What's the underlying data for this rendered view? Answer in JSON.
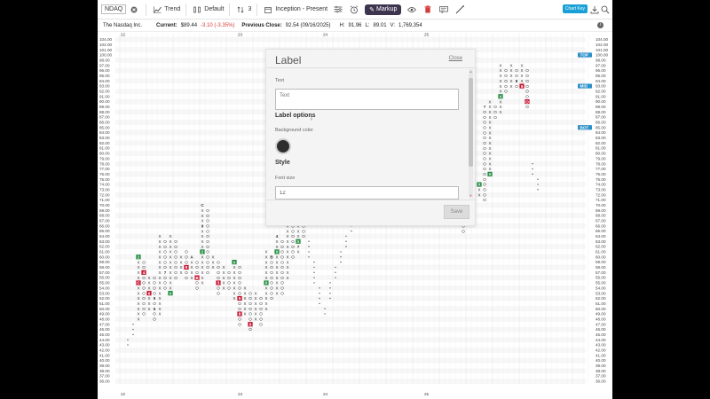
{
  "toolbar": {
    "symbol": "NDAQ",
    "trend_label": "Trend",
    "default_label": "Default",
    "count_label": "3",
    "range_label": "Inception - Present",
    "markup_label": "Markup",
    "chart_key_label": "Chart Key"
  },
  "info": {
    "company": "The Nasdaq Inc.",
    "current_label": "Current:",
    "current_value": "$89.44",
    "change": "-3.10 (-3.35%)",
    "prev_label": "Previous Close:",
    "prev_value": "92.54 (09/16/2025)",
    "high_label": "H:",
    "high_value": "91.96",
    "low_label": "L:",
    "low_value": "89.01",
    "vol_label": "V:",
    "vol_value": "1,769,354"
  },
  "modal": {
    "title": "Label",
    "close": "Close",
    "text_label": "Text",
    "text_placeholder": "Text",
    "options_heading": "Label options",
    "bg_label": "Background color",
    "bg_color": "#2d2d2d",
    "style_heading": "Style",
    "font_size_label": "Font size",
    "font_size_value": "12",
    "save": "Save"
  },
  "chart_data": {
    "type": "point-and-figure",
    "price_axis": [
      "104.00",
      "102.00",
      "101.00",
      "100.00",
      "98.00",
      "97.00",
      "96.00",
      "95.00",
      "94.00",
      "93.00",
      "92.00",
      "91.00",
      "90.00",
      "89.00",
      "88.00",
      "87.00",
      "86.00",
      "85.00",
      "84.00",
      "83.00",
      "82.00",
      "81.00",
      "80.00",
      "79.00",
      "78.00",
      "77.00",
      "76.00",
      "75.00",
      "74.00",
      "73.00",
      "72.00",
      "71.00",
      "70.00",
      "69.00",
      "68.00",
      "67.00",
      "66.00",
      "65.00",
      "64.00",
      "63.00",
      "62.00",
      "61.00",
      "60.00",
      "59.00",
      "58.00",
      "57.00",
      "56.00",
      "55.00",
      "54.00",
      "53.00",
      "52.00",
      "51.00",
      "50.00",
      "49.00",
      "48.00",
      "47.00",
      "46.00",
      "45.00",
      "44.00",
      "43.00",
      "42.00",
      "41.00",
      "40.00",
      "39.00",
      "38.00",
      "37.00",
      "36.00"
    ],
    "period_labels": [
      {
        "label": "22",
        "col": 0
      },
      {
        "label": "23",
        "col": 22
      },
      {
        "label": "24",
        "col": 38
      },
      {
        "label": "25",
        "col": 57
      }
    ],
    "right_tags": [
      {
        "label": "TOP",
        "price": 100
      },
      {
        "label": "MID",
        "price": 93
      },
      {
        "label": "BOT",
        "price": 85
      }
    ],
    "columns": [
      {
        "col": 1,
        "type": "dot",
        "from": 43,
        "to": 44
      },
      {
        "col": 2,
        "type": "dot",
        "from": 45,
        "to": 47
      },
      {
        "col": 3,
        "type": "X",
        "from": 48,
        "to": 60,
        "marks": [
          {
            "price": 55,
            "text": "C",
            "color": "#c8102e"
          },
          {
            "price": 60,
            "text": "2",
            "color": "#1e8a3c"
          }
        ]
      },
      {
        "col": 4,
        "type": "O",
        "from": 49,
        "to": 59,
        "marks": [
          {
            "price": 57,
            "text": "4",
            "color": "#c8102e"
          }
        ]
      },
      {
        "col": 5,
        "type": "X",
        "from": 50,
        "to": 56,
        "marks": [
          {
            "price": 53,
            "text": "6",
            "color": "#c8102e"
          }
        ]
      },
      {
        "col": 6,
        "type": "O",
        "from": 48,
        "to": 56,
        "marks": [
          {
            "price": 52,
            "text": "5",
            "color": "#333333"
          },
          {
            "price": 50,
            "text": "6",
            "color": "#333333"
          }
        ]
      },
      {
        "col": 7,
        "type": "X",
        "from": 49,
        "to": 64
      },
      {
        "col": 8,
        "type": "O",
        "from": 54,
        "to": 63,
        "marks": [
          {
            "price": 57,
            "text": "7",
            "color": "#333333"
          }
        ]
      },
      {
        "col": 9,
        "type": "X",
        "from": 53,
        "to": 64,
        "marks": [
          {
            "price": 53,
            "text": "X",
            "color": "#1e8a3c"
          }
        ]
      },
      {
        "col": 10,
        "type": "O",
        "from": 56,
        "to": 63
      },
      {
        "col": 11,
        "type": "X",
        "from": 57,
        "to": 60
      },
      {
        "col": 12,
        "type": "O",
        "from": 56,
        "to": 61,
        "marks": [
          {
            "price": 58,
            "text": "8",
            "color": "#c8102e"
          }
        ]
      },
      {
        "col": 13,
        "type": "X",
        "from": 56,
        "to": 60,
        "marks": [
          {
            "price": 60,
            "text": "A",
            "color": "#333333"
          }
        ]
      },
      {
        "col": 14,
        "type": "O",
        "from": 54,
        "to": 59,
        "marks": [
          {
            "price": 56,
            "text": "B",
            "color": "#c8102e"
          }
        ]
      },
      {
        "col": 15,
        "type": "X",
        "from": 55,
        "to": 70,
        "marks": [
          {
            "price": 70,
            "text": "C",
            "color": "#333333"
          },
          {
            "price": 61,
            "text": "2",
            "color": "#1e8a3c"
          },
          {
            "price": 66,
            "text": "9",
            "color": "#333333"
          }
        ]
      },
      {
        "col": 16,
        "type": "O",
        "from": 57,
        "to": 69
      },
      {
        "col": 17,
        "type": "X",
        "from": 58,
        "to": 60
      },
      {
        "col": 18,
        "type": "O",
        "from": 53,
        "to": 59,
        "marks": [
          {
            "price": 55,
            "text": "3",
            "color": "#c8102e"
          }
        ]
      },
      {
        "col": 19,
        "type": "X",
        "from": 54,
        "to": 58
      },
      {
        "col": 20,
        "type": "O",
        "from": 54,
        "to": 57
      },
      {
        "col": 21,
        "type": "X",
        "from": 52,
        "to": 59,
        "marks": [
          {
            "price": 59,
            "text": "X",
            "color": "#1e8a3c"
          }
        ]
      },
      {
        "col": 22,
        "type": "O",
        "from": 47,
        "to": 58,
        "marks": [
          {
            "price": 52,
            "text": "6",
            "color": "#c8102e"
          },
          {
            "price": 49,
            "text": "8",
            "color": "#c8102e"
          }
        ]
      },
      {
        "col": 23,
        "type": "X",
        "from": 49,
        "to": 54
      },
      {
        "col": 24,
        "type": "O",
        "from": 46,
        "to": 53,
        "marks": [
          {
            "price": 47,
            "text": "8",
            "color": "#c8102e"
          }
        ]
      },
      {
        "col": 25,
        "type": "X",
        "from": 48,
        "to": 53
      },
      {
        "col": 26,
        "type": "O",
        "from": 47,
        "to": 52
      },
      {
        "col": 27,
        "type": "X",
        "from": 50,
        "to": 61,
        "marks": [
          {
            "price": 55,
            "text": "X",
            "color": "#1e8a3c"
          }
        ]
      },
      {
        "col": 28,
        "type": "O",
        "from": 52,
        "to": 60,
        "marks": [
          {
            "price": 60,
            "text": "B",
            "color": "#333333"
          }
        ]
      },
      {
        "col": 29,
        "type": "X",
        "from": 53,
        "to": 64,
        "marks": [
          {
            "price": 64,
            "text": "4",
            "color": "#333333"
          },
          {
            "price": 61,
            "text": "X",
            "color": "#1e8a3c"
          }
        ]
      },
      {
        "col": 30,
        "type": "O",
        "from": 53,
        "to": 63
      },
      {
        "col": 31,
        "type": "X",
        "from": 56,
        "to": 67
      },
      {
        "col": 32,
        "type": "O",
        "from": 60,
        "to": 66
      },
      {
        "col": 33,
        "type": "X",
        "from": 61,
        "to": 67,
        "marks": [
          {
            "price": 63,
            "text": "X",
            "color": "#1e8a3c"
          },
          {
            "price": 62,
            "text": "7",
            "color": "#333333"
          }
        ]
      },
      {
        "col": 34,
        "type": "O",
        "from": 64,
        "to": 67
      },
      {
        "col": 35,
        "type": "dot",
        "from": 60,
        "to": 63
      },
      {
        "col": 36,
        "type": "dot",
        "from": 55,
        "to": 59
      },
      {
        "col": 37,
        "type": "dot",
        "from": 51,
        "to": 54
      },
      {
        "col": 38,
        "type": "dot",
        "from": 49,
        "to": 50
      },
      {
        "col": 39,
        "type": "dot",
        "from": 52,
        "to": 55
      },
      {
        "col": 40,
        "type": "dot",
        "from": 56,
        "to": 58
      },
      {
        "col": 41,
        "type": "dot",
        "from": 59,
        "to": 61
      },
      {
        "col": 42,
        "type": "dot",
        "from": 62,
        "to": 64
      },
      {
        "col": 43,
        "type": "dot",
        "from": 65,
        "to": 66
      },
      {
        "col": 64,
        "type": "O",
        "from": 65,
        "to": 70
      },
      {
        "col": 65,
        "type": "X",
        "from": 67,
        "to": 72
      },
      {
        "col": 66,
        "type": "O",
        "from": 68,
        "to": 73
      },
      {
        "col": 67,
        "type": "X",
        "from": 72,
        "to": 74,
        "marks": [
          {
            "price": 74,
            "text": "X",
            "color": "#1e8a3c"
          }
        ]
      },
      {
        "col": 68,
        "type": "O",
        "from": 71,
        "to": 89,
        "marks": [
          {
            "price": 89,
            "text": "7",
            "color": "#333333"
          }
        ]
      },
      {
        "col": 69,
        "type": "X",
        "from": 76,
        "to": 90,
        "marks": [
          {
            "price": 76,
            "text": "X",
            "color": "#1e8a3c"
          }
        ]
      },
      {
        "col": 70,
        "type": "O",
        "from": 87,
        "to": 89
      },
      {
        "col": 71,
        "type": "X",
        "from": 88,
        "to": 97,
        "marks": [
          {
            "price": 91,
            "text": "X",
            "color": "#1e8a3c"
          }
        ]
      },
      {
        "col": 72,
        "type": "O",
        "from": 92,
        "to": 96
      },
      {
        "col": 73,
        "type": "X",
        "from": 93,
        "to": 97
      },
      {
        "col": 74,
        "type": "O",
        "from": 93,
        "to": 96,
        "marks": [
          {
            "price": 94,
            "text": "8",
            "color": "#333333"
          }
        ]
      },
      {
        "col": 75,
        "type": "X",
        "from": 93,
        "to": 97,
        "marks": [
          {
            "price": 93,
            "text": "9",
            "color": "#c8102e"
          }
        ]
      },
      {
        "col": 76,
        "type": "O",
        "from": 89,
        "to": 96,
        "marks": [
          {
            "price": 90,
            "text": "O",
            "color": "#c8102e"
          }
        ]
      },
      {
        "col": 77,
        "type": "dot",
        "from": 76,
        "to": 78
      },
      {
        "col": 78,
        "type": "dot",
        "from": 73,
        "to": 75
      }
    ]
  }
}
